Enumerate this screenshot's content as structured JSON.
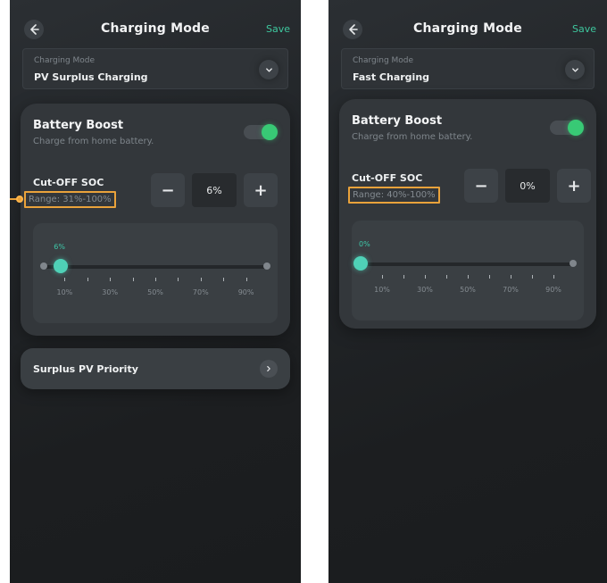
{
  "colors": {
    "accent_green": "#3ec79e",
    "toggle_on": "#38c975",
    "slider_thumb": "#4fd1b7",
    "highlight_orange": "#e9a23b"
  },
  "left": {
    "header": {
      "title": "Charging Mode",
      "save_label": "Save"
    },
    "mode_select": {
      "label": "Charging Mode",
      "value": "PV Surplus Charging"
    },
    "battery_boost": {
      "title": "Battery Boost",
      "subtitle": "Charge from home battery.",
      "enabled": true
    },
    "cutoff": {
      "title": "Cut-OFF SOC",
      "range": "Range: 31%-100%",
      "value": "6%",
      "minus": "−",
      "plus": "+"
    },
    "slider": {
      "current_label": "6%",
      "value_percent": 6,
      "tick_labels": [
        "10%",
        "30%",
        "50%",
        "70%",
        "90%"
      ]
    },
    "priority": {
      "label": "Surplus PV Priority"
    }
  },
  "right": {
    "header": {
      "title": "Charging Mode",
      "save_label": "Save"
    },
    "mode_select": {
      "label": "Charging Mode",
      "value": "Fast Charging"
    },
    "battery_boost": {
      "title": "Battery Boost",
      "subtitle": "Charge from home battery.",
      "enabled": true
    },
    "cutoff": {
      "title": "Cut-OFF SOC",
      "range": "Range: 40%-100%",
      "value": "0%",
      "minus": "−",
      "plus": "+"
    },
    "slider": {
      "current_label": "0%",
      "value_percent": 0,
      "tick_labels": [
        "10%",
        "30%",
        "50%",
        "70%",
        "90%"
      ]
    }
  }
}
